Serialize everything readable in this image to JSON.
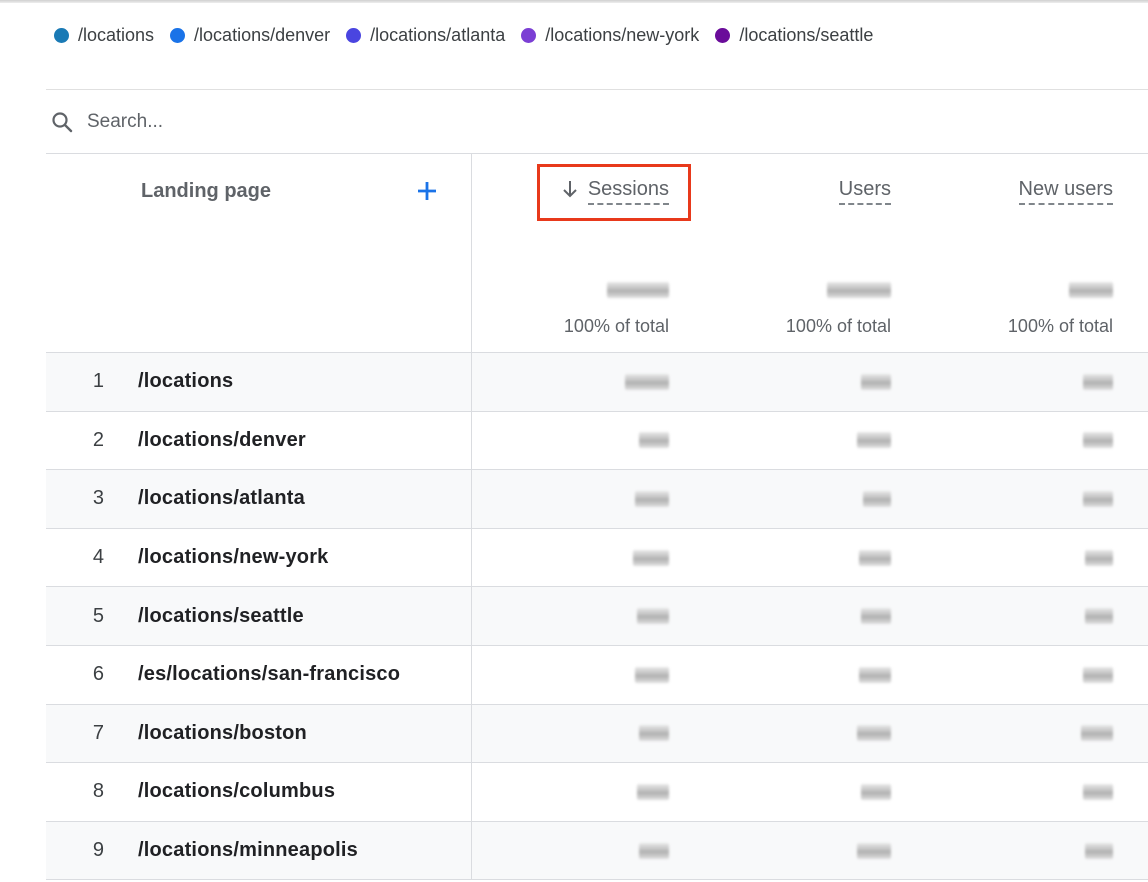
{
  "legend": {
    "items": [
      {
        "label": "/locations",
        "color": "#1a7ab5"
      },
      {
        "label": "/locations/denver",
        "color": "#1a73e8"
      },
      {
        "label": "/locations/atlanta",
        "color": "#4a45e0"
      },
      {
        "label": "/locations/new-york",
        "color": "#7b3fd4"
      },
      {
        "label": "/locations/seattle",
        "color": "#6a0c9a"
      }
    ]
  },
  "search": {
    "placeholder": "Search...",
    "value": "",
    "icon": "search-icon"
  },
  "table": {
    "dimension_header": "Landing page",
    "add_dimension_icon": "plus-icon",
    "metric_headers": [
      {
        "label": "Sessions",
        "sorted": "descending",
        "sort_icon": "arrow-down-icon",
        "highlighted": true,
        "highlight_color": "#e8391b"
      },
      {
        "label": "Users",
        "sorted": null
      },
      {
        "label": "New users",
        "sorted": null
      }
    ],
    "totals": [
      {
        "value": "[redacted]",
        "pct_label": "100% of total"
      },
      {
        "value": "[redacted]",
        "pct_label": "100% of total"
      },
      {
        "value": "[redacted]",
        "pct_label": "100% of total"
      }
    ],
    "rows": [
      {
        "index": "1",
        "page": "/locations",
        "sessions": "[redacted]",
        "users": "[redacted]",
        "new_users": "[redacted]"
      },
      {
        "index": "2",
        "page": "/locations/denver",
        "sessions": "[redacted]",
        "users": "[redacted]",
        "new_users": "[redacted]"
      },
      {
        "index": "3",
        "page": "/locations/atlanta",
        "sessions": "[redacted]",
        "users": "[redacted]",
        "new_users": "[redacted]"
      },
      {
        "index": "4",
        "page": "/locations/new-york",
        "sessions": "[redacted]",
        "users": "[redacted]",
        "new_users": "[redacted]"
      },
      {
        "index": "5",
        "page": "/locations/seattle",
        "sessions": "[redacted]",
        "users": "[redacted]",
        "new_users": "[redacted]"
      },
      {
        "index": "6",
        "page": "/es/locations/san-francisco",
        "sessions": "[redacted]",
        "users": "[redacted]",
        "new_users": "[redacted]"
      },
      {
        "index": "7",
        "page": "/locations/boston",
        "sessions": "[redacted]",
        "users": "[redacted]",
        "new_users": "[redacted]"
      },
      {
        "index": "8",
        "page": "/locations/columbus",
        "sessions": "[redacted]",
        "users": "[redacted]",
        "new_users": "[redacted]"
      },
      {
        "index": "9",
        "page": "/locations/minneapolis",
        "sessions": "[redacted]",
        "users": "[redacted]",
        "new_users": "[redacted]"
      }
    ]
  },
  "colors": {
    "accent": "#1a73e8",
    "highlight_box": "#e8391b",
    "row_shade": "#f8f9fa",
    "divider": "#dadce0"
  }
}
